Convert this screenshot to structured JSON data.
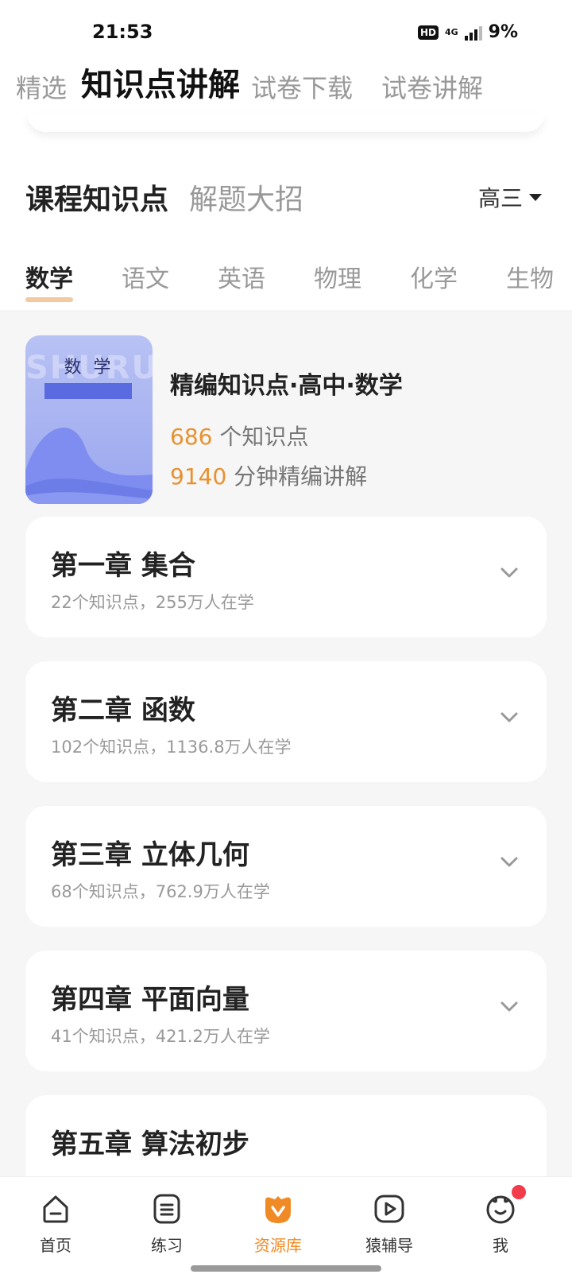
{
  "status_bar": {
    "time": "21:53",
    "hd": "HD",
    "network": "4G",
    "battery": "9%"
  },
  "top_tabs": [
    {
      "label": "精选"
    },
    {
      "label": "知识点讲解"
    },
    {
      "label": "试卷下载"
    },
    {
      "label": "试卷讲解"
    }
  ],
  "top_tabs_active": "知识点讲解",
  "section": {
    "tabs": [
      {
        "label": "课程知识点"
      },
      {
        "label": "解题大招"
      }
    ],
    "active": "课程知识点",
    "grade": "高三"
  },
  "subjects": [
    {
      "label": "数学"
    },
    {
      "label": "语文"
    },
    {
      "label": "英语"
    },
    {
      "label": "物理"
    },
    {
      "label": "化学"
    },
    {
      "label": "生物"
    }
  ],
  "subjects_active": "数学",
  "course": {
    "cover_title": "数 学",
    "cover_watermark": "SHURUE",
    "title": "精编知识点·高中·数学",
    "points_count": "686",
    "points_suffix": " 个知识点",
    "minutes_count": "9140",
    "minutes_suffix": " 分钟精编讲解"
  },
  "chapters": [
    {
      "title": "第一章 集合",
      "meta": "22个知识点，255万人在学"
    },
    {
      "title": "第二章 函数",
      "meta": "102个知识点，1136.8万人在学"
    },
    {
      "title": "第三章 立体几何",
      "meta": "68个知识点，762.9万人在学"
    },
    {
      "title": "第四章 平面向量",
      "meta": "41个知识点，421.2万人在学"
    },
    {
      "title": "第五章 算法初步",
      "meta": ""
    }
  ],
  "bottom_nav": [
    {
      "label": "首页",
      "icon": "home-icon"
    },
    {
      "label": "练习",
      "icon": "practice-icon"
    },
    {
      "label": "资源库",
      "icon": "resource-library-icon"
    },
    {
      "label": "猿辅导",
      "icon": "video-play-icon"
    },
    {
      "label": "我",
      "icon": "profile-avatar-icon"
    }
  ],
  "bottom_nav_active": "资源库",
  "colors": {
    "accent_orange": "#e8912f",
    "nav_active": "#f08a24",
    "tab_indicator_blue": "#3d8ef0",
    "subject_indicator": "#f3c9a0",
    "badge_red": "#f23b4b",
    "book_cover": "#9aa6ef"
  }
}
